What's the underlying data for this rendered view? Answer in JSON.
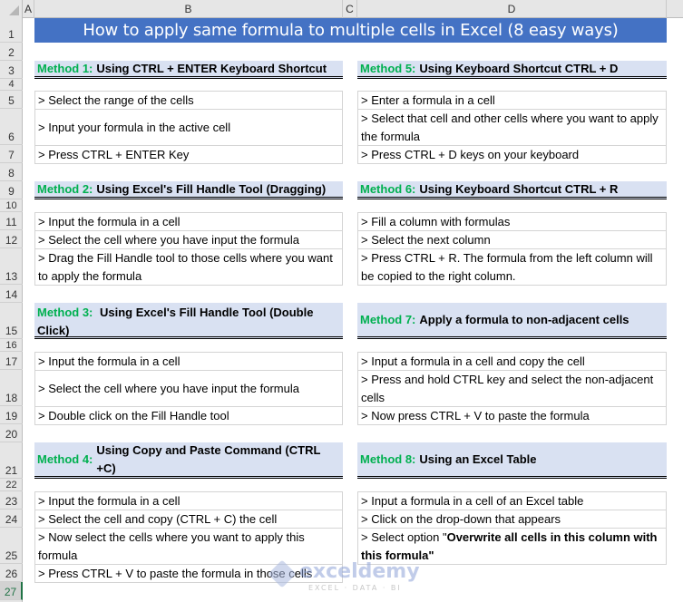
{
  "sheet": {
    "columns": [
      "A",
      "B",
      "C",
      "D"
    ],
    "rows": [
      "1",
      "2",
      "3",
      "4",
      "5",
      "6",
      "7",
      "8",
      "9",
      "10",
      "11",
      "12",
      "13",
      "14",
      "15",
      "16",
      "17",
      "18",
      "19",
      "20",
      "21",
      "22",
      "23",
      "24",
      "25",
      "26",
      "27"
    ],
    "selected_row": "27"
  },
  "title": "How to apply same formula to multiple cells in Excel (8 easy ways)",
  "methods": [
    {
      "label": "Method 1:",
      "text": "Using CTRL + ENTER Keyboard Shortcut",
      "steps": [
        "> Select the range of the cells",
        "> Input your formula in the active cell",
        "> Press CTRL + ENTER Key"
      ]
    },
    {
      "label": "Method 2:",
      "text": "Using Excel's Fill Handle Tool (Dragging)",
      "steps": [
        "> Input the formula in a cell",
        "> Select the cell where you have input the formula",
        "> Drag the Fill Handle tool to those cells where you want to apply the formula"
      ]
    },
    {
      "label": "Method 3:",
      "text": "Using Excel's Fill Handle Tool (Double Click)",
      "steps": [
        "> Input the formula in a cell",
        "> Select the cell where you have input the formula",
        "> Double click on the Fill Handle tool"
      ]
    },
    {
      "label": "Method 4:",
      "text": "Using Copy and Paste Command (CTRL +C)",
      "steps": [
        "> Input the formula in a cell",
        "> Select the cell and copy (CTRL + C) the cell",
        "> Now select the cells where you want to apply this formula",
        "> Press CTRL + V to paste the formula in those cells"
      ]
    },
    {
      "label": "Method 5:",
      "text": "Using Keyboard Shortcut CTRL + D",
      "steps": [
        "> Enter a formula in a cell",
        "> Select that cell and other cells where you want to apply the formula",
        "> Press CTRL + D keys on your keyboard"
      ]
    },
    {
      "label": "Method 6:",
      "text": "Using Keyboard Shortcut CTRL + R",
      "steps": [
        "> Fill a column with formulas",
        "> Select the next column",
        "> Press CTRL + R. The formula from the left column will be copied to the right column."
      ]
    },
    {
      "label": "Method 7:",
      "text": "Apply a formula to non-adjacent cells",
      "steps": [
        "> Input a formula in a cell and copy the cell",
        "> Press and hold CTRL key and select the non-adjacent cells",
        "> Now press CTRL + V to paste the formula"
      ]
    },
    {
      "label": "Method 8:",
      "text": "Using an Excel Table",
      "steps": [
        "> Input a formula in a cell of an Excel table",
        "> Click on the drop-down that appears"
      ],
      "step3_prefix": "> Select option \"",
      "step3_bold": "Overwrite all cells in this column with this formula\""
    }
  ],
  "watermark": {
    "name": "exceldemy",
    "tagline": "EXCEL · DATA · BI"
  },
  "colors": {
    "title_fill": "#4472c4",
    "method_fill": "#d9e1f2",
    "method_label": "#00b050",
    "selected_row": "#217346"
  }
}
